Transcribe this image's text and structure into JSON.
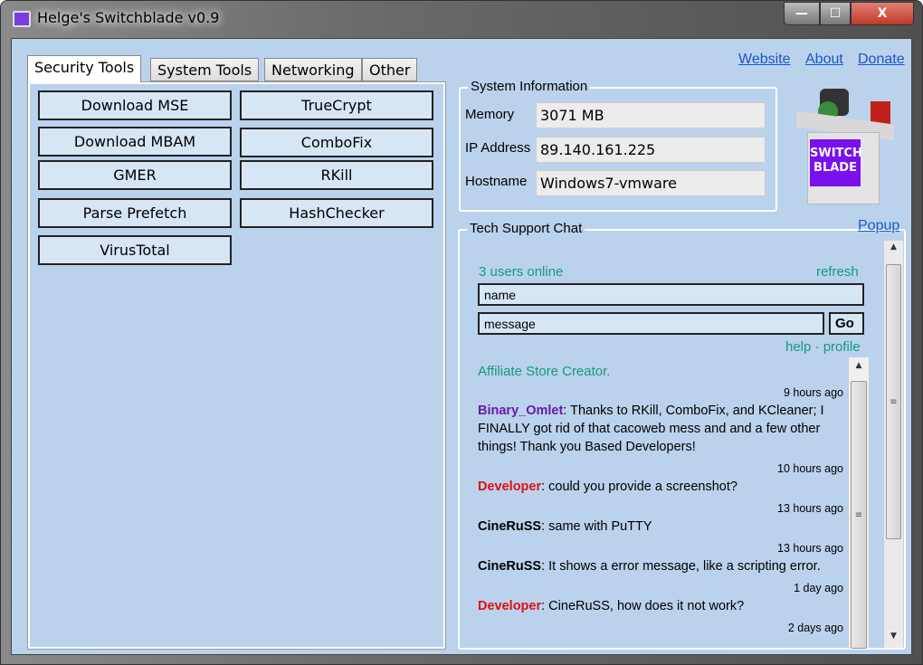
{
  "window": {
    "title": "Helge's Switchblade v0.9",
    "minimize": "—",
    "maximize": "☐",
    "close": "X"
  },
  "tabs": [
    {
      "label": "Security Tools"
    },
    {
      "label": "System Tools"
    },
    {
      "label": "Networking"
    },
    {
      "label": "Other"
    }
  ],
  "tools": [
    "Download MSE",
    "TrueCrypt",
    "Download MBAM",
    "ComboFix",
    "GMER",
    "RKill",
    "Parse Prefetch",
    "HashChecker",
    "VirusTotal"
  ],
  "links": {
    "website": "Website",
    "about": "About",
    "donate": "Donate",
    "popup": "Popup"
  },
  "sysinfo": {
    "title": "System Information",
    "memory_label": "Memory",
    "memory": "3071 MB",
    "ip_label": "IP Address",
    "ip": "89.140.161.225",
    "host_label": "Hostname",
    "host": "Windows7-vmware"
  },
  "logo": {
    "text": "SWITCH BLADE"
  },
  "chat": {
    "title": "Tech Support Chat",
    "online": "3 users online",
    "refresh": "refresh",
    "name_placeholder": "name",
    "message_placeholder": "message",
    "go": "Go",
    "help": "help",
    "sep": " · ",
    "profile": "profile",
    "affiliate": "Affiliate Store Creator.",
    "messages": [
      {
        "time": "9 hours ago",
        "user": "Binary_Omlet",
        "color": "#6a1aa8",
        "text": ": Thanks to RKill, ComboFix, and KCleaner; I FINALLY got rid of that cacoweb mess and and a few other things! Thank you Based Developers!"
      },
      {
        "time": "10 hours ago",
        "user": "Developer",
        "color": "#e01010",
        "text": ": could you provide a screenshot?"
      },
      {
        "time": "13 hours ago",
        "user": "CineRuSS",
        "color": "#000000",
        "text": ": same with PuTTY"
      },
      {
        "time": "13 hours ago",
        "user": "CineRuSS",
        "color": "#000000",
        "text": ": It shows a error message, like a scripting error."
      },
      {
        "time": "1 day ago",
        "user": "Developer",
        "color": "#e01010",
        "text": ": CineRuSS, how does it not work?"
      },
      {
        "time": "2 days ago",
        "user": "",
        "color": "#000000",
        "text": ""
      }
    ]
  }
}
